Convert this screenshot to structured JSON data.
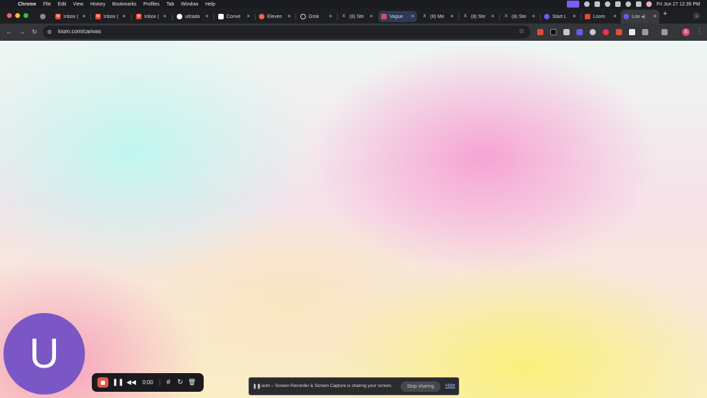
{
  "menubar": {
    "app": "Chrome",
    "menus": [
      "File",
      "Edit",
      "View",
      "History",
      "Bookmarks",
      "Profiles",
      "Tab",
      "Window",
      "Help"
    ],
    "clock": "Fri Jun 27  12:35 PM"
  },
  "tabs": [
    {
      "label": "",
      "icon": "chrome-icon",
      "color": "#8a8a8a"
    },
    {
      "label": "Inbox (",
      "icon": "gmail-icon",
      "color": "#ea4335"
    },
    {
      "label": "Inbox (",
      "icon": "gmail-icon",
      "color": "#ea4335"
    },
    {
      "label": "Inbox (",
      "icon": "gmail-icon",
      "color": "#ea4335"
    },
    {
      "label": "ultrada",
      "icon": "github-icon",
      "color": "#ffffff"
    },
    {
      "label": "Conve",
      "icon": "doc-icon",
      "color": "#ffffff"
    },
    {
      "label": "Eleven",
      "icon": "elevenlabs-icon",
      "color": "#e06a4f"
    },
    {
      "label": "Grok",
      "icon": "grok-icon",
      "color": "#dddddd"
    },
    {
      "label": "(8) Ste",
      "icon": "x-icon",
      "color": "#dddddd"
    },
    {
      "label": "Vague",
      "icon": "vague-icon",
      "color": "#d94b6b"
    },
    {
      "label": "(8) Me",
      "icon": "x-icon",
      "color": "#dddddd"
    },
    {
      "label": "(8) Ste",
      "icon": "x-icon",
      "color": "#dddddd"
    },
    {
      "label": "(8) Ste",
      "icon": "x-icon",
      "color": "#dddddd"
    },
    {
      "label": "Start L",
      "icon": "loom-icon",
      "color": "#625df5"
    },
    {
      "label": "Loom",
      "icon": "loom-mail-icon",
      "color": "#ea4335"
    },
    {
      "label": "Loo",
      "icon": "loom-icon",
      "color": "#625df5"
    }
  ],
  "address": {
    "url": "loom.com/canvas"
  },
  "profile_initial": "S",
  "avatar_initial": "U",
  "recorder": {
    "timer": "0:00"
  },
  "share_banner": {
    "message": "Loom – Screen Recorder & Screen Capture is sharing your screen.",
    "stop_label": "Stop sharing",
    "hide_label": "Hide"
  },
  "colors": {
    "loom_purple": "#7a57c4",
    "stop_red": "#e4574a"
  }
}
